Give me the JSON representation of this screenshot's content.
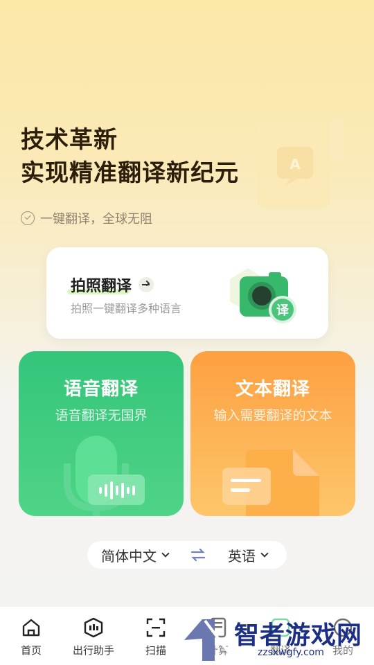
{
  "hero": {
    "title_line1": "技术革新",
    "title_line2": "实现精准翻译新纪元",
    "subtitle": "一键翻译，全球无阻"
  },
  "photo_card": {
    "title": "拍照翻译",
    "description": "拍照一键翻译多种语言",
    "badge": "译"
  },
  "tiles": {
    "voice": {
      "title": "语音翻译",
      "description": "语音翻译无国界"
    },
    "text": {
      "title": "文本翻译",
      "description": "输入需要翻译的文本"
    }
  },
  "language_bar": {
    "source": "简体中文",
    "target": "英语"
  },
  "tabbar": {
    "home": "首页",
    "travel": "出行助手",
    "scan": "扫描",
    "calc": "计算",
    "tab5": "翻译",
    "mine": "我的"
  },
  "watermark": {
    "text": "智者游戏网",
    "url": "zzsxwgfy.com"
  },
  "colors": {
    "voice_green": "#34c57a",
    "text_orange": "#fda041",
    "brand_text": "#2c1e0a"
  }
}
